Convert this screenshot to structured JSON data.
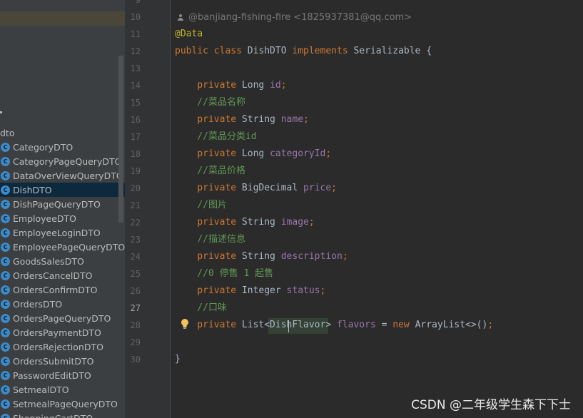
{
  "project_tree": {
    "folder": "dto",
    "items": [
      {
        "label": "CategoryDTO",
        "selected": false
      },
      {
        "label": "CategoryPageQueryDTO",
        "selected": false
      },
      {
        "label": "DataOverViewQueryDTO",
        "selected": false
      },
      {
        "label": "DishDTO",
        "selected": true
      },
      {
        "label": "DishPageQueryDTO",
        "selected": false
      },
      {
        "label": "EmployeeDTO",
        "selected": false
      },
      {
        "label": "EmployeeLoginDTO",
        "selected": false
      },
      {
        "label": "EmployeePageQueryDTO",
        "selected": false
      },
      {
        "label": "GoodsSalesDTO",
        "selected": false
      },
      {
        "label": "OrdersCancelDTO",
        "selected": false
      },
      {
        "label": "OrdersConfirmDTO",
        "selected": false
      },
      {
        "label": "OrdersDTO",
        "selected": false
      },
      {
        "label": "OrdersPageQueryDTO",
        "selected": false
      },
      {
        "label": "OrdersPaymentDTO",
        "selected": false
      },
      {
        "label": "OrdersRejectionDTO",
        "selected": false
      },
      {
        "label": "OrdersSubmitDTO",
        "selected": false
      },
      {
        "label": "PasswordEditDTO",
        "selected": false
      },
      {
        "label": "SetmealDTO",
        "selected": false
      },
      {
        "label": "SetmealPageQueryDTO",
        "selected": false
      },
      {
        "label": "ShoppingCartDTO",
        "selected": false
      }
    ],
    "class_icon_glyph": "C",
    "class_icon_color": "#3d8ac9"
  },
  "editor": {
    "author_hint": "@banjiang-fishing-fire <1825937381@qq.com>",
    "current_line": "27",
    "line_numbers": [
      "9",
      "10",
      "11",
      "12",
      "13",
      "14",
      "15",
      "16",
      "17",
      "18",
      "19",
      "20",
      "21",
      "22",
      "23",
      "24",
      "25",
      "26",
      "27",
      "28",
      "29",
      "30"
    ],
    "lines": [
      {
        "num": "10",
        "tokens": [
          {
            "t": "@Data",
            "c": "anno"
          }
        ]
      },
      {
        "num": "11",
        "tokens": [
          {
            "t": "public class ",
            "c": "kw"
          },
          {
            "t": "DishDTO ",
            "c": "plain"
          },
          {
            "t": "implements ",
            "c": "kw"
          },
          {
            "t": "Serializable {",
            "c": "plain"
          }
        ]
      },
      {
        "num": "12",
        "tokens": []
      },
      {
        "num": "13",
        "tokens": [
          {
            "t": "    private ",
            "c": "kw"
          },
          {
            "t": "Long ",
            "c": "plain"
          },
          {
            "t": "id",
            "c": "field"
          },
          {
            "t": ";",
            "c": "kw"
          }
        ]
      },
      {
        "num": "14",
        "tokens": [
          {
            "t": "    //菜品名称",
            "c": "comment"
          }
        ]
      },
      {
        "num": "15",
        "tokens": [
          {
            "t": "    private ",
            "c": "kw"
          },
          {
            "t": "String ",
            "c": "plain"
          },
          {
            "t": "name",
            "c": "field"
          },
          {
            "t": ";",
            "c": "kw"
          }
        ]
      },
      {
        "num": "16",
        "tokens": [
          {
            "t": "    //菜品分类id",
            "c": "comment"
          }
        ]
      },
      {
        "num": "17",
        "tokens": [
          {
            "t": "    private ",
            "c": "kw"
          },
          {
            "t": "Long ",
            "c": "plain"
          },
          {
            "t": "categoryId",
            "c": "field"
          },
          {
            "t": ";",
            "c": "kw"
          }
        ]
      },
      {
        "num": "18",
        "tokens": [
          {
            "t": "    //菜品价格",
            "c": "comment"
          }
        ]
      },
      {
        "num": "19",
        "tokens": [
          {
            "t": "    private ",
            "c": "kw"
          },
          {
            "t": "BigDecimal ",
            "c": "plain"
          },
          {
            "t": "price",
            "c": "field"
          },
          {
            "t": ";",
            "c": "kw"
          }
        ]
      },
      {
        "num": "20",
        "tokens": [
          {
            "t": "    //图片",
            "c": "comment"
          }
        ]
      },
      {
        "num": "21",
        "tokens": [
          {
            "t": "    private ",
            "c": "kw"
          },
          {
            "t": "String ",
            "c": "plain"
          },
          {
            "t": "image",
            "c": "field"
          },
          {
            "t": ";",
            "c": "kw"
          }
        ]
      },
      {
        "num": "22",
        "tokens": [
          {
            "t": "    //描述信息",
            "c": "comment"
          }
        ]
      },
      {
        "num": "23",
        "tokens": [
          {
            "t": "    private ",
            "c": "kw"
          },
          {
            "t": "String ",
            "c": "plain"
          },
          {
            "t": "description",
            "c": "field"
          },
          {
            "t": ";",
            "c": "kw"
          }
        ]
      },
      {
        "num": "24",
        "tokens": [
          {
            "t": "    //0 停售 1 起售",
            "c": "comment"
          }
        ]
      },
      {
        "num": "25",
        "tokens": [
          {
            "t": "    private ",
            "c": "kw"
          },
          {
            "t": "Integer ",
            "c": "plain"
          },
          {
            "t": "status",
            "c": "field"
          },
          {
            "t": ";",
            "c": "kw"
          }
        ]
      },
      {
        "num": "26",
        "tokens": [
          {
            "t": "    //口味",
            "c": "comment"
          }
        ]
      },
      {
        "num": "27",
        "tokens": [
          {
            "t": "    private ",
            "c": "kw"
          },
          {
            "t": "List<DishFlavor> ",
            "c": "plain"
          },
          {
            "t": "flavors ",
            "c": "field"
          },
          {
            "t": "= ",
            "c": "plain"
          },
          {
            "t": "new ",
            "c": "kw"
          },
          {
            "t": "ArrayList<>()",
            "c": "plain"
          },
          {
            "t": ";",
            "c": "kw"
          }
        ]
      },
      {
        "num": "28",
        "tokens": []
      },
      {
        "num": "29",
        "tokens": [
          {
            "t": "}",
            "c": "plain"
          }
        ]
      },
      {
        "num": "30",
        "tokens": []
      }
    ]
  },
  "watermark": "CSDN @二年级学生森下下士",
  "colors": {
    "keyword": "#cc7832",
    "annotation": "#bbb529",
    "field": "#9876aa",
    "comment": "#629755",
    "plain": "#a9b7c6",
    "editor_bg": "#2b2b2b",
    "tree_bg": "#3c3f41",
    "selection_bg": "#0d293e"
  }
}
